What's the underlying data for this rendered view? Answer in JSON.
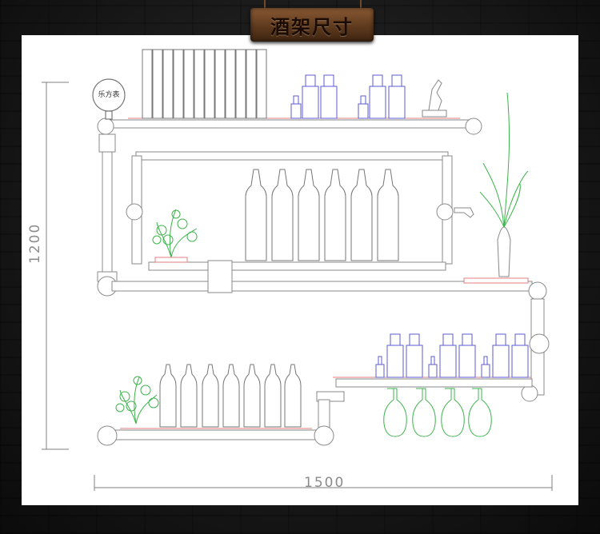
{
  "header": {
    "title": "酒架尺寸"
  },
  "dimensions": {
    "width_label": "1500",
    "height_label": "1200"
  },
  "gauge": {
    "label": "乐方表"
  },
  "colors": {
    "pipe": "#9a9a9a",
    "bottle": "#5b5bd6",
    "plant": "#3cb44b",
    "shelf_edge": "#e08080",
    "plank": "#6b4326",
    "dimension_line": "#7f7f7f"
  }
}
